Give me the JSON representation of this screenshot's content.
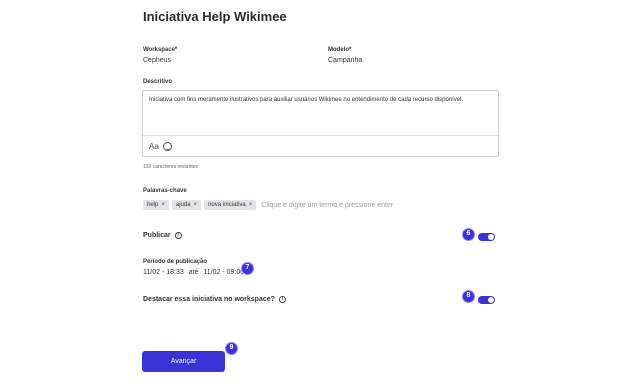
{
  "page": {
    "title": "Iniciativa Help Wikimee"
  },
  "workspace": {
    "label": "Workspace*",
    "value": "Cepheus"
  },
  "modelo": {
    "label": "Modelo*",
    "value": "Campanha"
  },
  "description": {
    "label": "Descritivo",
    "text": "Iniciativa com fins meramente ilustrativos para auxiliar usuários Wikimee no entendimento de cada recurso disponível.",
    "format_button": "Aa",
    "emoji_icon": "smile-icon",
    "chars_remaining": "133 caracteres restantes"
  },
  "keywords": {
    "label": "Palavras-chave",
    "chips": [
      "help",
      "ajuda",
      "nova iniciativa"
    ],
    "remove_glyph": "×",
    "placeholder": "Clique e digite um termo e pressione enter"
  },
  "publish": {
    "label": "Publicar",
    "info_glyph": "i",
    "enabled": true
  },
  "period": {
    "label": "Período de publicação",
    "start": "11/02 - 18:33",
    "separator": "até",
    "end": "11/02 - 09:00"
  },
  "highlight": {
    "label": "Destacar essa iniciativa no workspace?",
    "info_glyph": "i",
    "enabled": true
  },
  "badges": {
    "b6": "6",
    "b7": "7",
    "b8": "8",
    "b9": "9"
  },
  "actions": {
    "next_label": "Avançar"
  },
  "colors": {
    "accent": "#3a33d6",
    "badge": "#3b30e0"
  }
}
